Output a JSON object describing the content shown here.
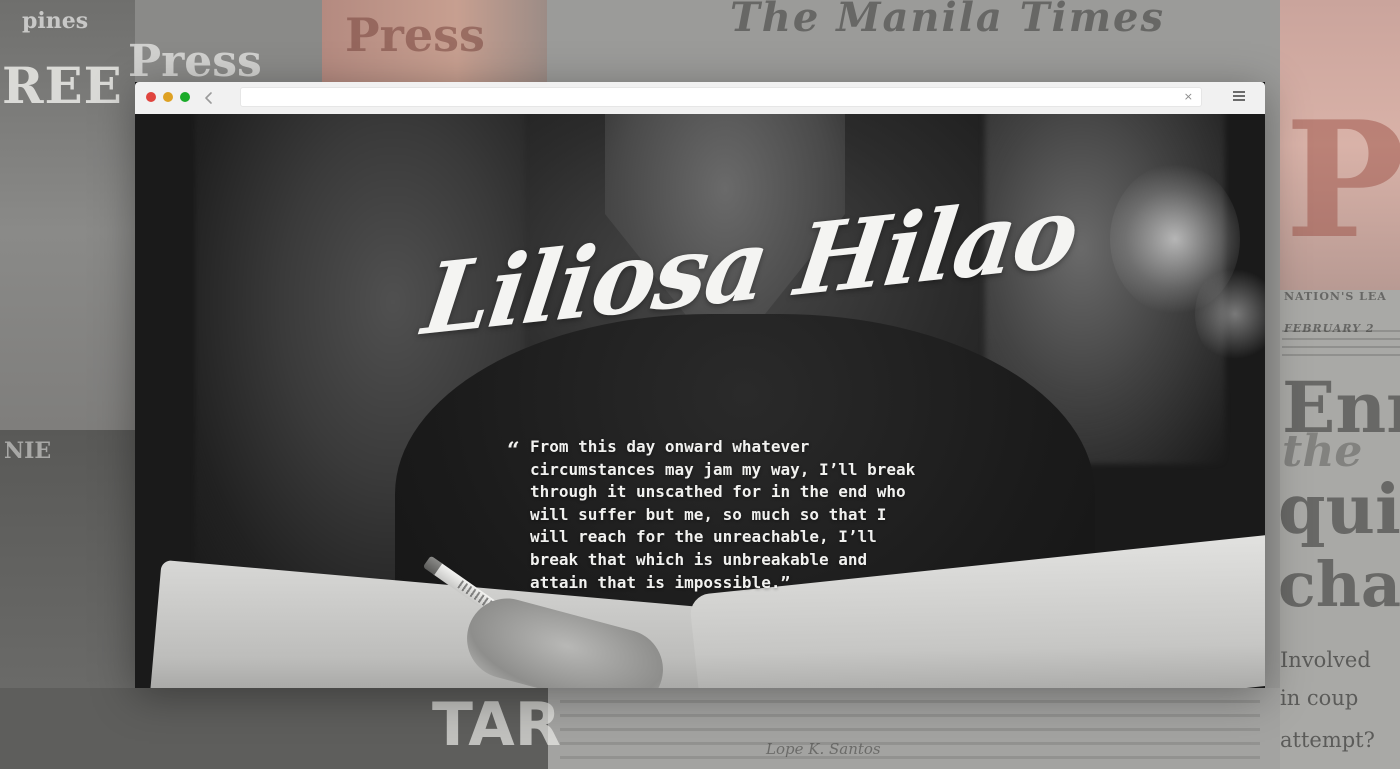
{
  "background": {
    "word_pines": "pines",
    "word_ree": "REE",
    "word_press": "Press",
    "word_press2": "Press",
    "word_manila": "The Manila Times",
    "word_nie": "NIE",
    "word_po": "PO",
    "word_nation": "NATION'S LEA",
    "word_feb": "FEBRUARY 2",
    "word_enr": "Enr",
    "word_the": "the",
    "word_quit": "quit",
    "word_cha": "cha",
    "word_involved": "Involved",
    "word_coup": "in coup",
    "word_attempt": "attempt?",
    "word_tar": "TAR",
    "word_lope": "Lope K. Santos"
  },
  "browser": {
    "traffic_lights": {
      "close": "#e0443e",
      "minimize": "#dea123",
      "maximize": "#1aab29"
    },
    "back_icon": "chevron-left-icon",
    "url_value": "",
    "clear_label": "×",
    "menu_icon": "hamburger-menu-icon"
  },
  "page": {
    "signature": "Liliosa Hilao",
    "quote_open": "“",
    "quote": "From this day onward whatever\ncircumstances may jam my way, I’ll break\nthrough it unscathed for in the end who\nwill suffer but me, so much so that I\nwill reach for the unreachable, I’ll\nbreak that which is unbreakable and\nattain that is impossible.”"
  }
}
